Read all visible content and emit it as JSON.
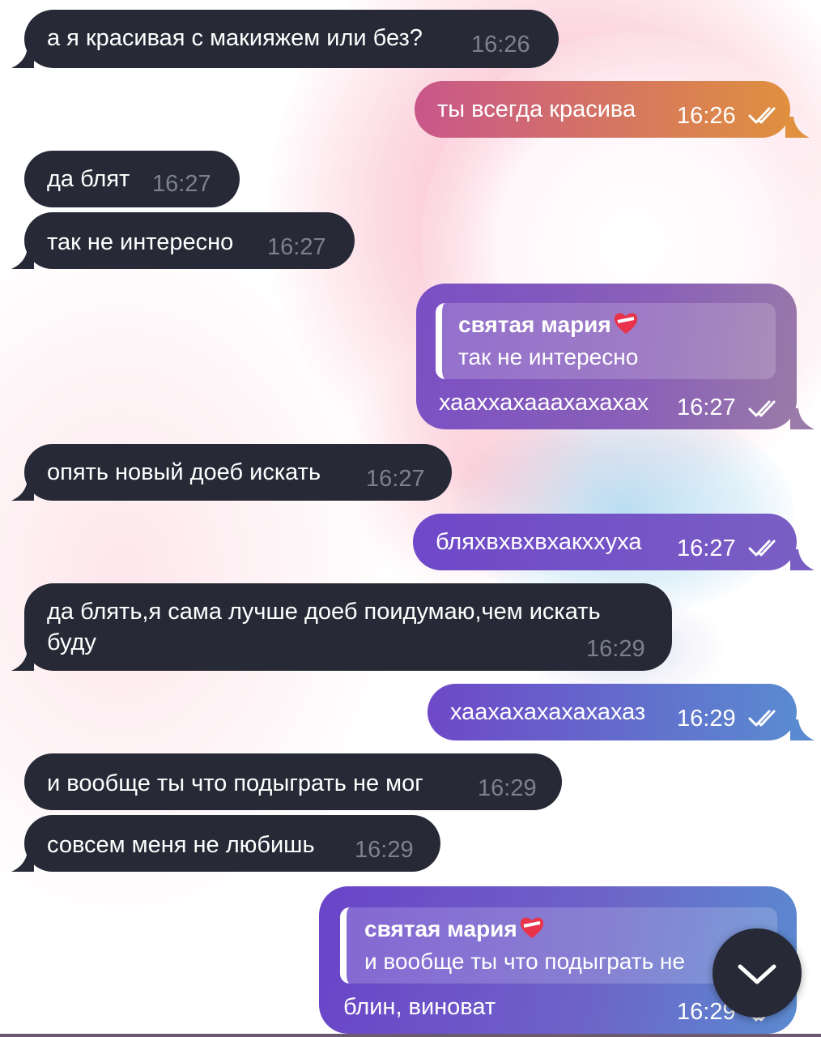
{
  "contact": {
    "name": "святая мария"
  },
  "colors": {
    "incoming_bubble": "#272a36",
    "outgoing_gradient_start": "#6e48c8",
    "outgoing_gradient_end": "#5a8bd0",
    "outgoing_warm_start": "#c8578a",
    "outgoing_warm_end": "#e0903e"
  },
  "messages": [
    {
      "direction": "in",
      "text": "а я красивая с макияжем или без?",
      "time": "16:26"
    },
    {
      "direction": "out",
      "text": "ты всегда красива",
      "time": "16:26",
      "status": "read"
    },
    {
      "direction": "in",
      "text": "да блят",
      "time": "16:27"
    },
    {
      "direction": "in",
      "text": "так не интересно",
      "time": "16:27"
    },
    {
      "direction": "out",
      "reply_to": {
        "author": "святая мария",
        "text": "так не интересно"
      },
      "text": "хааххахааахахахах",
      "time": "16:27",
      "status": "read"
    },
    {
      "direction": "in",
      "text": "опять новый доеб искать",
      "time": "16:27"
    },
    {
      "direction": "out",
      "text": "бляхвхвхвхакххуха",
      "time": "16:27",
      "status": "read"
    },
    {
      "direction": "in",
      "text_line1": "да блять,я сама лучше доеб поидумаю,чем искать",
      "text_line2": "буду",
      "time": "16:29"
    },
    {
      "direction": "out",
      "text": "хаахахахахахахаз",
      "time": "16:29",
      "status": "read"
    },
    {
      "direction": "in",
      "text": "и вообще ты что подыграть не мог",
      "time": "16:29"
    },
    {
      "direction": "in",
      "text": "совсем меня не любишь",
      "time": "16:29"
    },
    {
      "direction": "out",
      "reply_to": {
        "author": "святая мария",
        "text": "и вообще ты что подыграть не"
      },
      "text": "блин, виноват",
      "time": "16:29",
      "status": "read"
    }
  ],
  "scroll_down_button": {
    "icon": "chevron-down-icon"
  }
}
